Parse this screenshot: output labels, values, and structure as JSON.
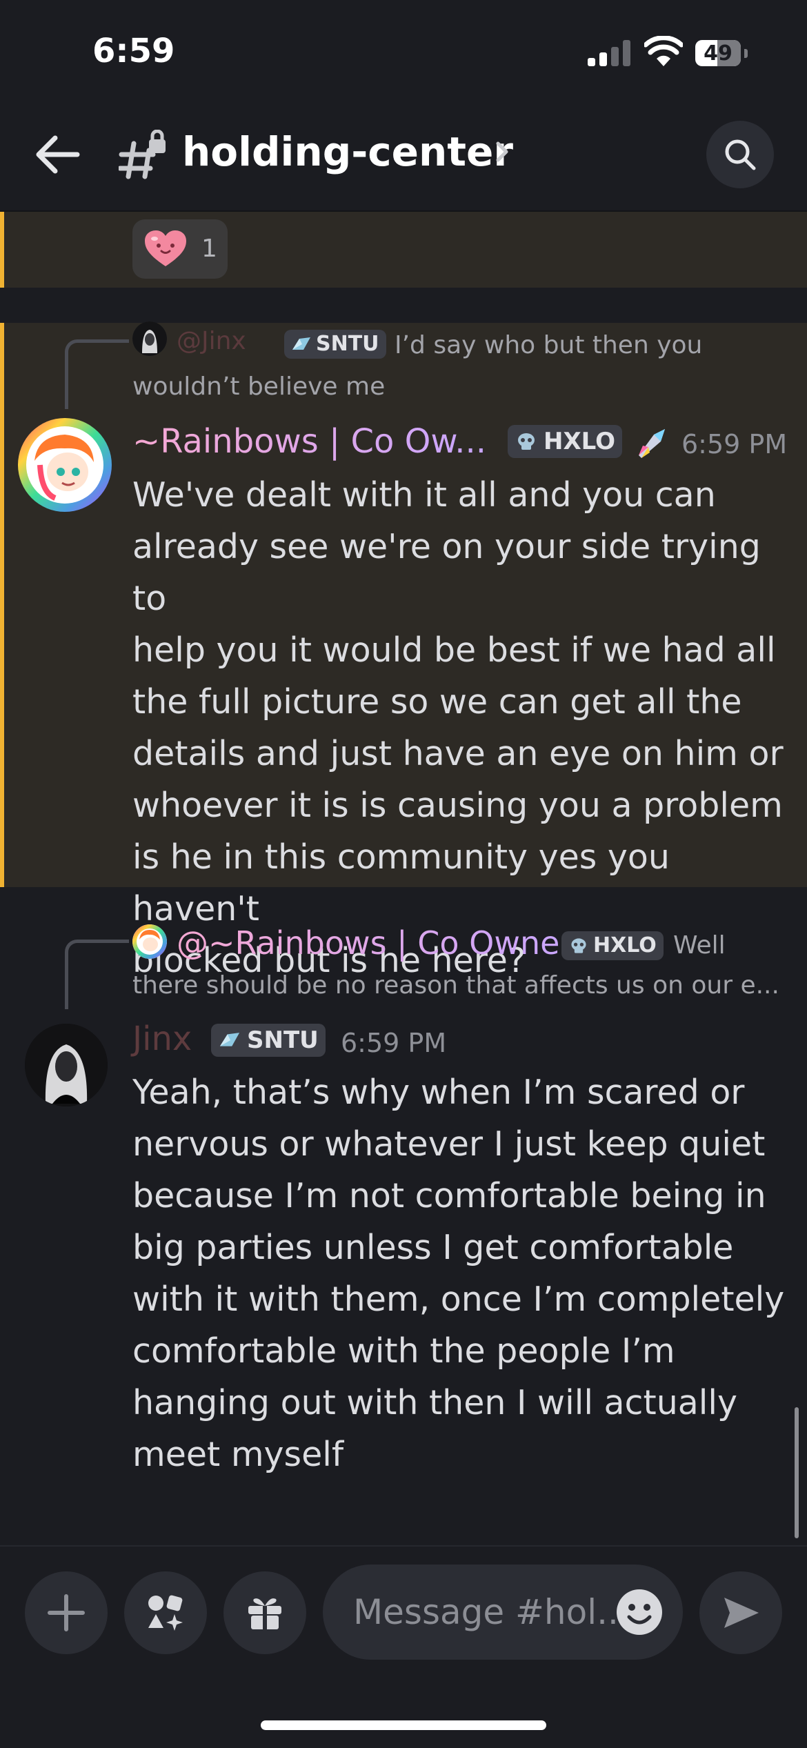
{
  "status_bar": {
    "time": "6:59",
    "battery": "49"
  },
  "header": {
    "channel_name": "holding-center"
  },
  "reaction": {
    "emoji": "heart",
    "count": "1"
  },
  "messages": [
    {
      "reply": {
        "mention": "@Jinx",
        "tag": "SNTU",
        "text_line1": "I’d say who but then you",
        "text_line2": "wouldn’t believe me"
      },
      "author": "~Rainbows | Co Ow...",
      "author_color": "#f2a7d6",
      "tag": "HXLO",
      "timestamp": "6:59 PM",
      "lines": [
        "We've dealt with it all and you can",
        "already see we're on your side trying to",
        "help you it would be best if we had all",
        "the full picture so we can get all the",
        "details and just have an eye on him or",
        "whoever it is is causing you a problem",
        "is he in this community yes you haven't",
        "blocked but is he here?"
      ]
    },
    {
      "reply": {
        "mention": "@~Rainbows | Co Owner",
        "tag": "HXLO",
        "text_line1": "Well",
        "text_line2": "there should be no reason that affects us on our e..."
      },
      "author": "Jinx",
      "author_color": "#5e3b3e",
      "tag": "SNTU",
      "timestamp": "6:59 PM",
      "lines": [
        "Yeah, that’s why when I’m scared or",
        "nervous or whatever I just keep quiet",
        "because I’m not comfortable being in",
        "big parties unless I get comfortable",
        "with it with them, once I’m completely",
        "comfortable with the people I’m",
        "hanging out with then I will actually",
        "meet myself"
      ]
    }
  ],
  "composer": {
    "placeholder": "Message #hol.."
  },
  "colors": {
    "highlight_bar": "#f0b232",
    "highlight_bg": "#2d2a25",
    "background": "#1b1c21"
  }
}
